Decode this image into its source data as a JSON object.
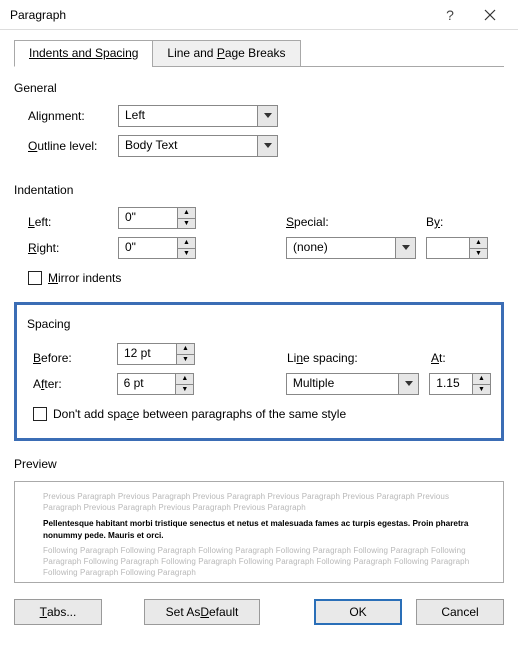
{
  "titlebar": {
    "title": "Paragraph"
  },
  "tabs": {
    "indents": "Indents and Spacing",
    "breaks": "Line and Page Breaks"
  },
  "general": {
    "header": "General",
    "alignment_label_pre": "Ali",
    "alignment_label_u": "g",
    "alignment_label_post": "nment:",
    "alignment_value": "Left",
    "outline_label_u": "O",
    "outline_label_post": "utline level:",
    "outline_value": "Body Text"
  },
  "indentation": {
    "header": "Indentation",
    "left_label_u": "L",
    "left_label_post": "eft:",
    "left_value": "0\"",
    "right_label_u": "R",
    "right_label_post": "ight:",
    "right_value": "0\"",
    "special_label_u": "S",
    "special_label_post": "pecial:",
    "special_value": "(none)",
    "by_label_pre": "B",
    "by_label_u": "y",
    "by_label_post": ":",
    "by_value": "",
    "mirror_label_u": "M",
    "mirror_label_post": "irror indents"
  },
  "spacing": {
    "header": "Spacing",
    "before_label_u": "B",
    "before_label_post": "efore:",
    "before_value": "12 pt",
    "after_label_pre": "A",
    "after_label_u": "f",
    "after_label_post": "ter:",
    "after_value": "6 pt",
    "linespacing_label_pre": "Li",
    "linespacing_label_u": "n",
    "linespacing_label_post": "e spacing:",
    "linespacing_value": "Multiple",
    "at_label_u": "A",
    "at_label_post": "t:",
    "at_value": "1.15",
    "dontadd_pre": "Don't add spa",
    "dontadd_u": "c",
    "dontadd_post": "e between paragraphs of the same style"
  },
  "preview": {
    "header": "Preview",
    "prev1": "Previous Paragraph Previous Paragraph Previous Paragraph Previous Paragraph Previous Paragraph Previous Paragraph Previous Paragraph Previous Paragraph Previous Paragraph",
    "sample": "Pellentesque habitant morbi tristique senectus et netus et malesuada fames ac turpis egestas. Proin pharetra nonummy pede. Mauris et orci.",
    "next1": "Following Paragraph Following Paragraph Following Paragraph Following Paragraph Following Paragraph Following Paragraph Following Paragraph Following Paragraph Following Paragraph Following Paragraph Following Paragraph Following Paragraph Following Paragraph"
  },
  "footer": {
    "tabs": "Tabs...",
    "setdefault": "Set As Default",
    "ok": "OK",
    "cancel": "Cancel"
  }
}
